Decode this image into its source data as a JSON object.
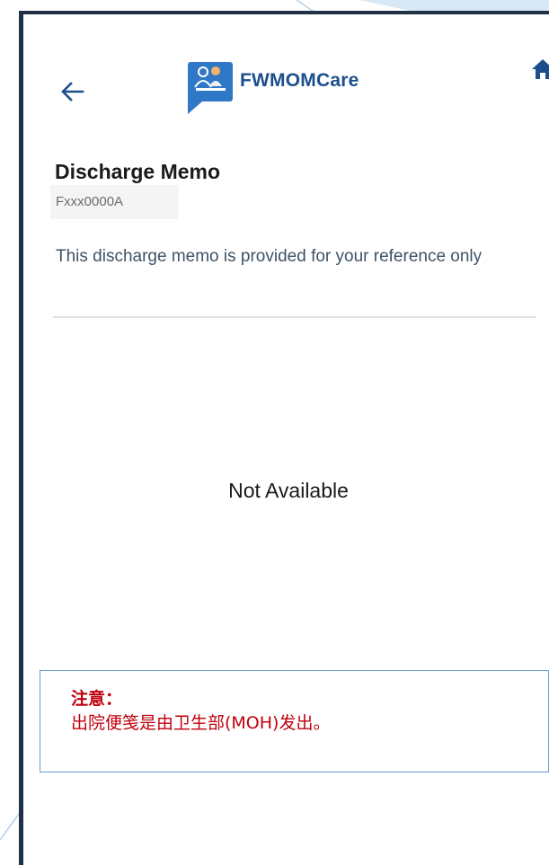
{
  "app": {
    "name": "FWMOMCare"
  },
  "header": {
    "back_icon": "arrow-left-icon",
    "logo_icon": "fwmomcare-logo-icon",
    "home_icon": "home-icon"
  },
  "page": {
    "title": "Discharge Memo",
    "id_value": "Fxxx0000A",
    "note": "This discharge memo is provided for your reference only",
    "empty_text": "Not Available"
  },
  "callout": {
    "title": "注意：",
    "text": "出院便笺是由卫生部(MOH)发出。"
  },
  "colors": {
    "brand": "#1b4f8c",
    "frame": "#1f3147",
    "callout_border": "#6d9bd1",
    "callout_text": "#c0000d",
    "deco_blue": "#d8e8f5"
  }
}
